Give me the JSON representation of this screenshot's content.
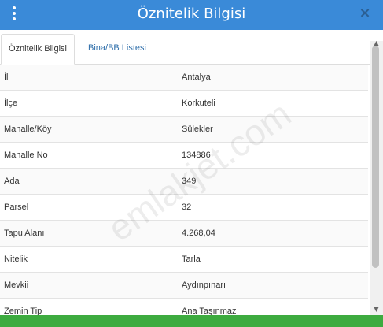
{
  "header": {
    "title": "Öznitelik Bilgisi",
    "menu_icon": "kebab-menu-icon",
    "close_icon": "close-icon",
    "close_glyph": "×"
  },
  "tabs": [
    {
      "label": "Öznitelik Bilgisi",
      "active": true
    },
    {
      "label": "Bina/BB Listesi",
      "active": false
    }
  ],
  "attributes": [
    {
      "key": "İl",
      "value": "Antalya"
    },
    {
      "key": "İlçe",
      "value": "Korkuteli"
    },
    {
      "key": "Mahalle/Köy",
      "value": "Sülekler"
    },
    {
      "key": "Mahalle No",
      "value": "134886"
    },
    {
      "key": "Ada",
      "value": "349"
    },
    {
      "key": "Parsel",
      "value": "32"
    },
    {
      "key": "Tapu Alanı",
      "value": "4.268,04"
    },
    {
      "key": "Nitelik",
      "value": "Tarla"
    },
    {
      "key": "Mevkii",
      "value": "Aydınpınarı"
    },
    {
      "key": "Zemin Tip",
      "value": "Ana Taşınmaz"
    }
  ],
  "watermark": "emlakjet.com",
  "colors": {
    "header": "#3a8ad8",
    "footer": "#3dab3f",
    "tab_link": "#2f6fab"
  }
}
